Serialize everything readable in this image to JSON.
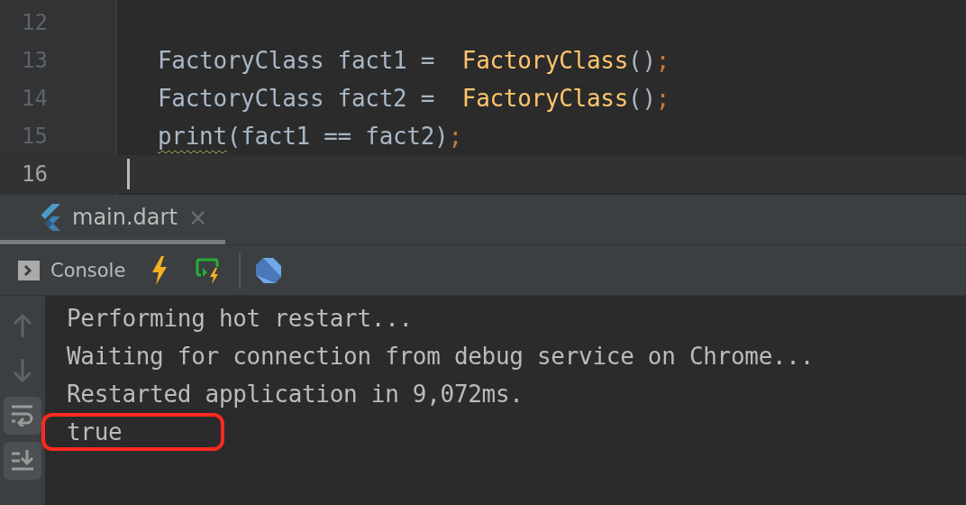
{
  "editor": {
    "lines": [
      {
        "number": "12",
        "current": false
      },
      {
        "number": "13",
        "current": false,
        "tokens": [
          {
            "text": "FactoryClass fact1 =  ",
            "kind": "plain"
          },
          {
            "text": "FactoryClass",
            "kind": "call"
          },
          {
            "text": "()",
            "kind": "plain"
          },
          {
            "text": ";",
            "kind": "punct"
          }
        ]
      },
      {
        "number": "14",
        "current": false,
        "tokens": [
          {
            "text": "FactoryClass fact2 =  ",
            "kind": "plain"
          },
          {
            "text": "FactoryClass",
            "kind": "call"
          },
          {
            "text": "()",
            "kind": "plain"
          },
          {
            "text": ";",
            "kind": "punct"
          }
        ]
      },
      {
        "number": "15",
        "current": false,
        "tokens": [
          {
            "text": "print",
            "kind": "warn"
          },
          {
            "text": "(fact1 == fact2)",
            "kind": "plain"
          },
          {
            "text": ";",
            "kind": "punct"
          }
        ]
      },
      {
        "number": "16",
        "current": true
      }
    ]
  },
  "run_tabs": [
    {
      "label": "main.dart",
      "selected": true,
      "close": "×"
    }
  ],
  "toolbar": {
    "console_label": "Console"
  },
  "side_tools": [
    {
      "kind": "up",
      "selected": false
    },
    {
      "kind": "down",
      "selected": false
    },
    {
      "kind": "wrap",
      "selected": true
    },
    {
      "kind": "scroll-end",
      "selected": true
    }
  ],
  "console": [
    {
      "text": "Performing hot restart...",
      "highlighted": false
    },
    {
      "text": "Waiting for connection from debug service on Chrome...",
      "highlighted": false
    },
    {
      "text": "Restarted application in 9,072ms.",
      "highlighted": false
    },
    {
      "text": "true",
      "highlighted": true
    }
  ]
}
